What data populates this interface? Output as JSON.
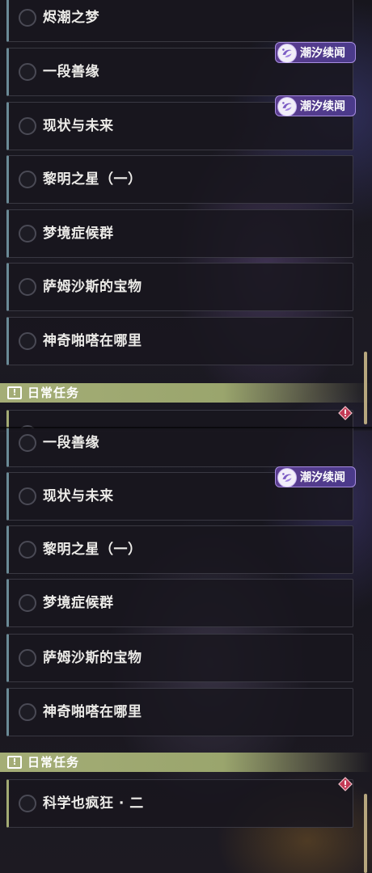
{
  "tag_label": "潮汐续闻",
  "section_daily": "日常任务",
  "panel_a": {
    "quests": [
      "烬潮之梦",
      "一段善缘",
      "现状与未来",
      "黎明之星（一）",
      "梦境症候群",
      "萨姆沙斯的宝物",
      "神奇啪嗒在哪里"
    ],
    "daily_quests": [
      ""
    ]
  },
  "panel_b": {
    "quests": [
      "一段善缘",
      "现状与未来",
      "黎明之星（一）",
      "梦境症候群",
      "萨姆沙斯的宝物",
      "神奇啪嗒在哪里"
    ],
    "daily_quests": [
      "科学也疯狂 · 二"
    ]
  },
  "colors": {
    "daily_header": "#a4ad76",
    "badge": "#5a3c8e",
    "alert": "#c23a55"
  }
}
